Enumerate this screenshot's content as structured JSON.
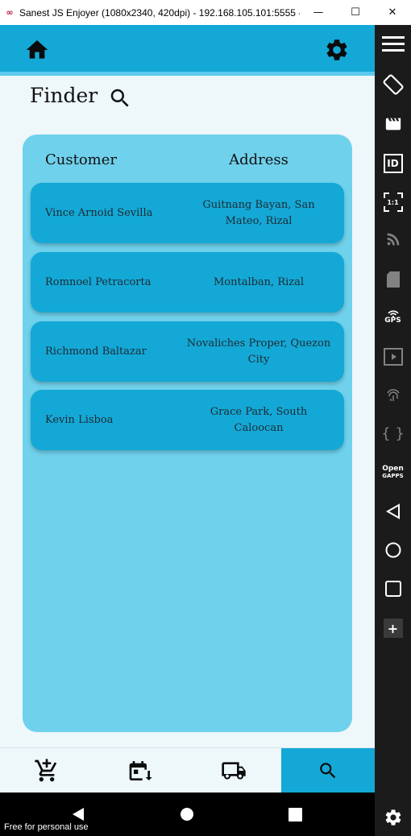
{
  "window": {
    "title": "Sanest JS Enjoyer (1080x2340, 420dpi) - 192.168.105.101:5555 -...",
    "minimize": "—",
    "maximize": "☐",
    "close": "✕"
  },
  "app": {
    "page_title": "Finder",
    "table": {
      "headers": {
        "customer": "Customer",
        "address": "Address"
      },
      "rows": [
        {
          "customer": "Vince Arnoid Sevilla",
          "address": "Guitnang Bayan, San Mateo, Rizal"
        },
        {
          "customer": "Romnoel Petracorta",
          "address": "Montalban, Rizal"
        },
        {
          "customer": "Richmond Baltazar",
          "address": "Novaliches Proper, Quezon City"
        },
        {
          "customer": "Kevin Lisboa",
          "address": "Grace Park, South Caloocan"
        }
      ]
    },
    "bottom_nav": [
      {
        "icon": "cart-icon"
      },
      {
        "icon": "calendar-sort-icon"
      },
      {
        "icon": "delivery-truck-icon"
      },
      {
        "icon": "search-icon",
        "active": true
      }
    ]
  },
  "emulator": {
    "watermark": "Free for personal use",
    "sidebar": {
      "gps_label": "GPS",
      "id_label": "ID",
      "ratio_label": "1:1",
      "braces_label": "{ }",
      "opengapps_label_1": "Open",
      "opengapps_label_2": "GAPPS",
      "plus_label": "+"
    }
  },
  "colors": {
    "primary": "#14a8d6",
    "card": "#6fd1ec",
    "background": "#eef7fa",
    "accent_border": "#5ccbee"
  }
}
